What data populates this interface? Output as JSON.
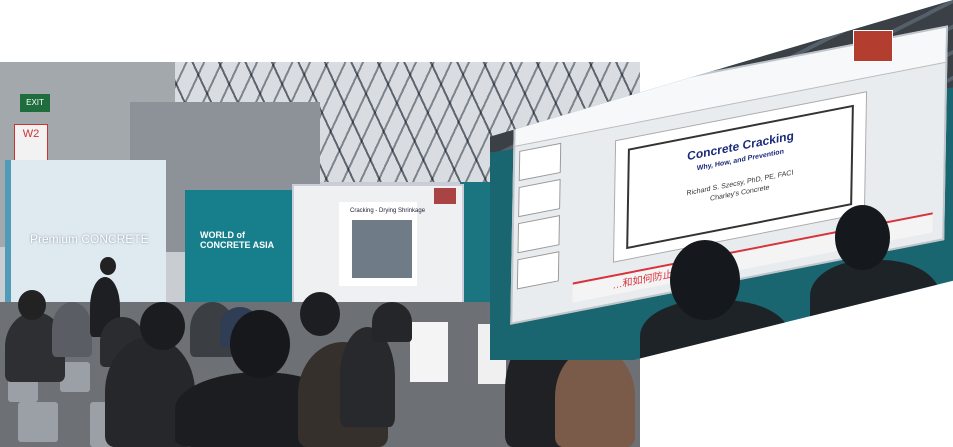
{
  "hall": {
    "exit_sign": "EXIT",
    "w2_sign": "W2",
    "booth_text": "Premium CONCRETE",
    "stage_logo": "WORLD of CONCRETE ASIA",
    "slide_title": "Cracking - Drying Shrinkage"
  },
  "big_screen": {
    "slide_title": "Concrete Cracking",
    "slide_subtitle": "Why, How, and Prevention",
    "author": "Richard S. Szecsy, PhD, PE, FACI",
    "org": "Charley's Concrete",
    "caption": "…和如何防止开裂"
  },
  "colors": {
    "teal": "#177f8c",
    "caption_red": "#d7333a",
    "slide_title_blue": "#1b2a7a"
  }
}
